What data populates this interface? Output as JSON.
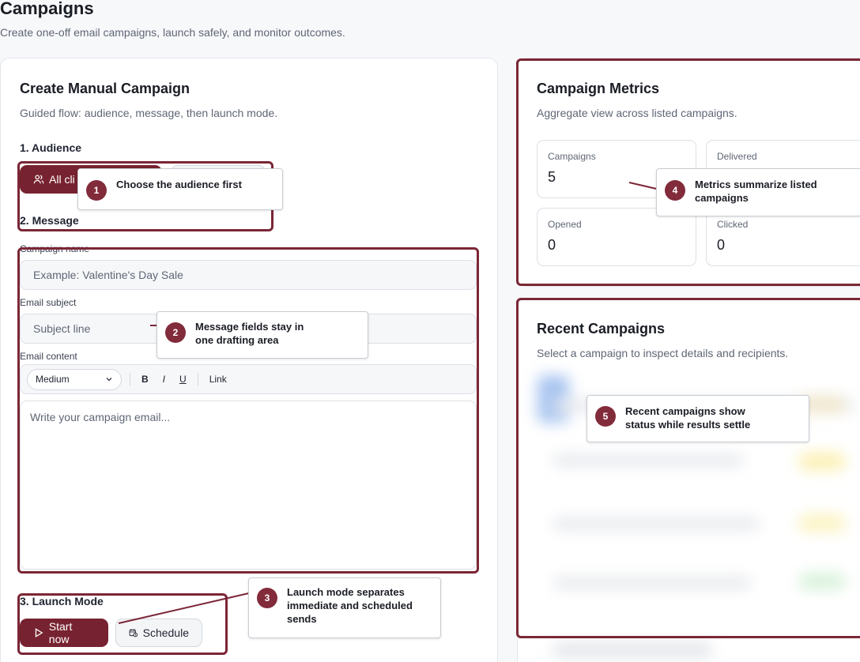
{
  "header": {
    "title": "Campaigns",
    "subtitle": "Create one-off email campaigns, launch safely, and monitor outcomes."
  },
  "create": {
    "title": "Create Manual Campaign",
    "description": "Guided flow: audience, message, then launch mode.",
    "audience": {
      "label": "1. Audience",
      "all_clients": "All cli"
    },
    "message": {
      "label": "2. Message",
      "name_label": "Campaign name",
      "name_placeholder": "Example: Valentine's Day Sale",
      "subject_label": "Email subject",
      "subject_placeholder": "Subject line",
      "content_label": "Email content",
      "content_placeholder": "Write your campaign email...",
      "toolbar": {
        "size": "Medium",
        "bold": "B",
        "italic": "I",
        "underline": "U",
        "link": "Link"
      }
    },
    "launch": {
      "label": "3. Launch Mode",
      "start_now": "Start now",
      "schedule": "Schedule"
    }
  },
  "metrics": {
    "title": "Campaign Metrics",
    "description": "Aggregate view across listed campaigns.",
    "items": [
      {
        "label": "Campaigns",
        "value": "5"
      },
      {
        "label": "Delivered",
        "value": ""
      },
      {
        "label": "Opened",
        "value": "0"
      },
      {
        "label": "Clicked",
        "value": "0"
      }
    ]
  },
  "recent": {
    "title": "Recent Campaigns",
    "description": "Select a campaign to inspect details and recipients."
  },
  "callouts": [
    {
      "number": "1",
      "text": "Choose the audience first"
    },
    {
      "number": "2",
      "text": "Message fields stay in one drafting area"
    },
    {
      "number": "3",
      "text": "Launch mode separates immediate and scheduled sends"
    },
    {
      "number": "4",
      "text": "Metrics summarize listed campaigns"
    },
    {
      "number": "5",
      "text": "Recent campaigns show status while results settle"
    }
  ],
  "colors": {
    "brand": "#772230",
    "highlight": "#7b2636",
    "badge": "#822b3b"
  }
}
